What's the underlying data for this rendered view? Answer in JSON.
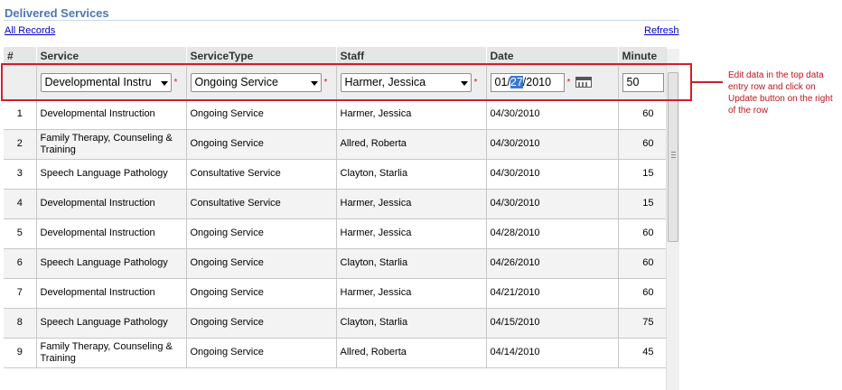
{
  "header": {
    "title": "Delivered Services",
    "all_records": "All Records",
    "refresh": "Refresh"
  },
  "columns": [
    "#",
    "Service",
    "ServiceType",
    "Staff",
    "Date",
    "Minute"
  ],
  "entry": {
    "service": "Developmental Instru",
    "service_type": "Ongoing Service",
    "staff": "Harmer, Jessica",
    "date_pre": "01/",
    "date_sel": "27",
    "date_post": "/2010",
    "minutes": "50",
    "required_mark": "*"
  },
  "rows": [
    {
      "num": "1",
      "service": "Developmental Instruction",
      "type": "Ongoing Service",
      "staff": "Harmer, Jessica",
      "date": "04/30/2010",
      "minutes": "60"
    },
    {
      "num": "2",
      "service": "Family Therapy, Counseling & Training",
      "type": "Ongoing Service",
      "staff": "Allred, Roberta",
      "date": "04/30/2010",
      "minutes": "60"
    },
    {
      "num": "3",
      "service": "Speech Language Pathology",
      "type": "Consultative Service",
      "staff": "Clayton, Starlia",
      "date": "04/30/2010",
      "minutes": "15"
    },
    {
      "num": "4",
      "service": "Developmental Instruction",
      "type": "Consultative Service",
      "staff": "Harmer, Jessica",
      "date": "04/30/2010",
      "minutes": "15"
    },
    {
      "num": "5",
      "service": "Developmental Instruction",
      "type": "Ongoing Service",
      "staff": "Harmer, Jessica",
      "date": "04/28/2010",
      "minutes": "60"
    },
    {
      "num": "6",
      "service": "Speech Language Pathology",
      "type": "Ongoing Service",
      "staff": "Clayton, Starlia",
      "date": "04/26/2010",
      "minutes": "60"
    },
    {
      "num": "7",
      "service": "Developmental Instruction",
      "type": "Ongoing Service",
      "staff": "Harmer, Jessica",
      "date": "04/21/2010",
      "minutes": "60"
    },
    {
      "num": "8",
      "service": "Speech Language Pathology",
      "type": "Ongoing Service",
      "staff": "Clayton, Starlia",
      "date": "04/15/2010",
      "minutes": "75"
    },
    {
      "num": "9",
      "service": "Family Therapy, Counseling & Training",
      "type": "Ongoing Service",
      "staff": "Allred, Roberta",
      "date": "04/14/2010",
      "minutes": "45"
    }
  ],
  "annotation": "Edit data in the top data entry row and click on Update button on the right of the row",
  "colors": {
    "title": "#4a78b6",
    "highlight_box": "#d0202a",
    "link": "#0000cc"
  }
}
